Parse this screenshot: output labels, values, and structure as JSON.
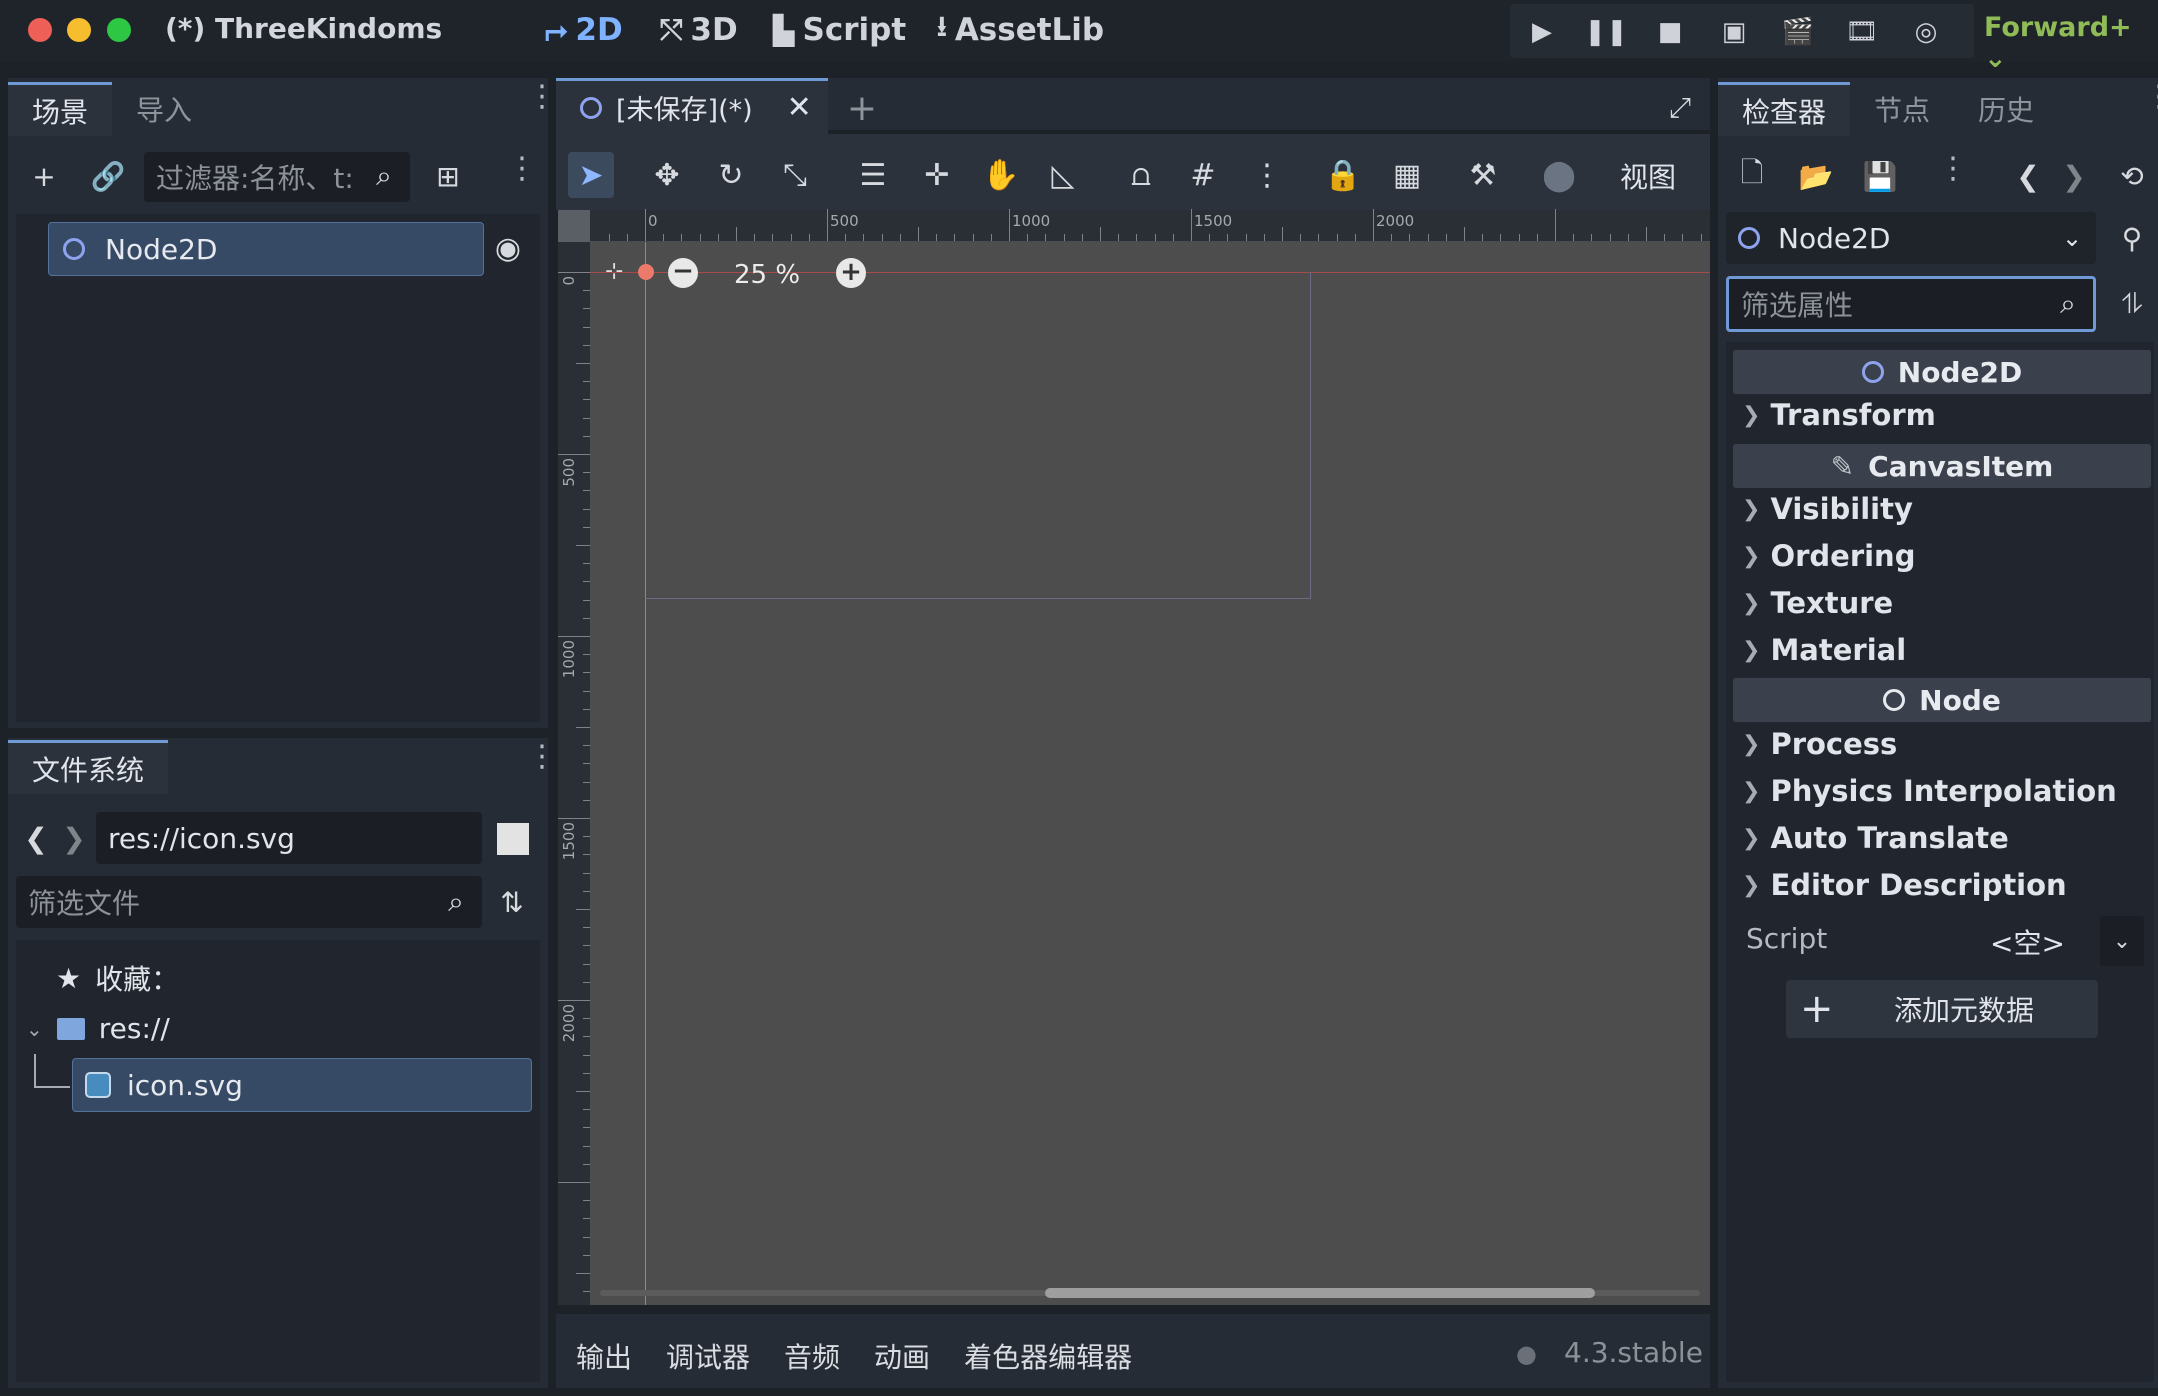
{
  "window": {
    "title": "(*) ThreeKindoms"
  },
  "workspaces": [
    {
      "label": "2D",
      "icon": "⮣",
      "active": true
    },
    {
      "label": "3D",
      "icon": "⤲",
      "active": false
    },
    {
      "label": "Script",
      "icon": "▙",
      "active": false
    },
    {
      "label": "AssetLib",
      "icon": "⭳",
      "active": false
    }
  ],
  "renderer": "Forward+",
  "scene_dock": {
    "tabs": [
      "场景",
      "导入"
    ],
    "filter_placeholder": "过滤器:名称、t:",
    "tree": [
      {
        "label": "Node2D"
      }
    ]
  },
  "filesystem_dock": {
    "tab": "文件系统",
    "path": "res://icon.svg",
    "filter_placeholder": "筛选文件",
    "favorites_label": "收藏：",
    "root_label": "res://",
    "file_label": "icon.svg"
  },
  "editor": {
    "tab_label": "[未保存](*)",
    "view_menu": "视图",
    "zoom": "25 %",
    "ruler_labels_h": [
      "0",
      "500",
      "1000",
      "1500",
      "2000"
    ],
    "ruler_labels_v": [
      "0",
      "500",
      "1000",
      "1500",
      "2000"
    ]
  },
  "bottom_panel": {
    "tabs": [
      "输出",
      "调试器",
      "音频",
      "动画",
      "着色器编辑器"
    ],
    "version": "4.3.stable"
  },
  "inspector": {
    "tabs": [
      "检查器",
      "节点",
      "历史"
    ],
    "node_selector": "Node2D",
    "filter_placeholder": "筛选属性",
    "sections": {
      "node2d": "Node2D",
      "transform": "Transform",
      "canvasitem": "CanvasItem",
      "visibility": "Visibility",
      "ordering": "Ordering",
      "texture": "Texture",
      "material": "Material",
      "node": "Node",
      "process": "Process",
      "physics": "Physics Interpolation",
      "autotranslate": "Auto Translate",
      "editordesc": "Editor Description"
    },
    "script_label": "Script",
    "script_value": "<空>",
    "add_metadata": "添加元数据"
  },
  "colors": {
    "accent": "#7fb2ff",
    "renderer": "#8fbc57",
    "canvas": "#4d4d4d",
    "selection": "#364a66"
  }
}
